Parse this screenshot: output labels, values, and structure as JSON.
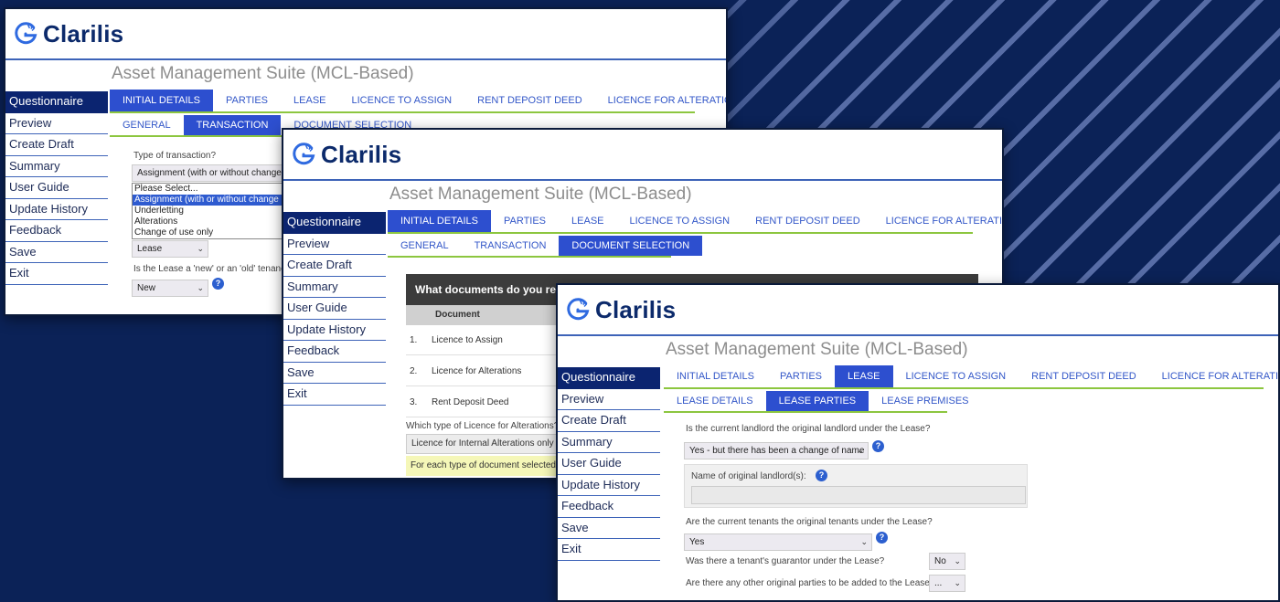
{
  "brand": {
    "name": "Clarilis",
    "logo_icon": "clarilis-logo-icon",
    "accent": "#2d4fcf",
    "navy": "#0b2470",
    "green_rule": "#8cc63f"
  },
  "app_title": "Asset Management Suite (MCL-Based)",
  "sidebar": {
    "items": [
      {
        "label": "Questionnaire"
      },
      {
        "label": "Preview"
      },
      {
        "label": "Create Draft"
      },
      {
        "label": "Summary"
      },
      {
        "label": "User Guide"
      },
      {
        "label": "Update History"
      },
      {
        "label": "Feedback"
      },
      {
        "label": "Save"
      },
      {
        "label": "Exit"
      }
    ]
  },
  "tabs": {
    "main": [
      "INITIAL DETAILS",
      "PARTIES",
      "LEASE",
      "LICENCE TO ASSIGN",
      "RENT DEPOSIT DEED",
      "LICENCE FOR ALTERATIONS"
    ],
    "initial_sub": [
      "GENERAL",
      "TRANSACTION",
      "DOCUMENT SELECTION"
    ],
    "lease_sub": [
      "LEASE DETAILS",
      "LEASE PARTIES",
      "LEASE PREMISES"
    ]
  },
  "window1": {
    "q_type": "Type of transaction?",
    "type_value": "Assignment (with or without change of use)",
    "dropdown_options": [
      "Please Select...",
      "Assignment (with or without change of use)",
      "Underletting",
      "Alterations",
      "Change of use only"
    ],
    "dropdown_selected": 1,
    "lease_value": "Lease",
    "q_tenancy": "Is the Lease a 'new' or an 'old' tenancy?",
    "tenancy_value": "New"
  },
  "window2": {
    "doc_header": "What documents do you require?",
    "col_document": "Document",
    "documents": [
      {
        "num": "1.",
        "name": "Licence to Assign"
      },
      {
        "num": "2.",
        "name": "Licence for Alterations"
      },
      {
        "num": "3.",
        "name": "Rent Deposit Deed"
      }
    ],
    "q_licence_type": "Which type of Licence for Alterations?",
    "licence_type_value": "Licence for Internal Alterations only",
    "notice": "For each type of document selected above"
  },
  "window3": {
    "q_landlord": "Is the current landlord the original landlord under the Lease?",
    "landlord_value": "Yes - but there has been a change of name",
    "orig_landlord_label": "Name of original landlord(s):",
    "q_tenants": "Are the current tenants the original tenants under the Lease?",
    "tenants_value": "Yes",
    "q_guarantor": "Was there a tenant's guarantor under the Lease?",
    "guarantor_value": "No",
    "q_other": "Are there any other original parties to be added to the Lease?",
    "other_value": "..."
  }
}
